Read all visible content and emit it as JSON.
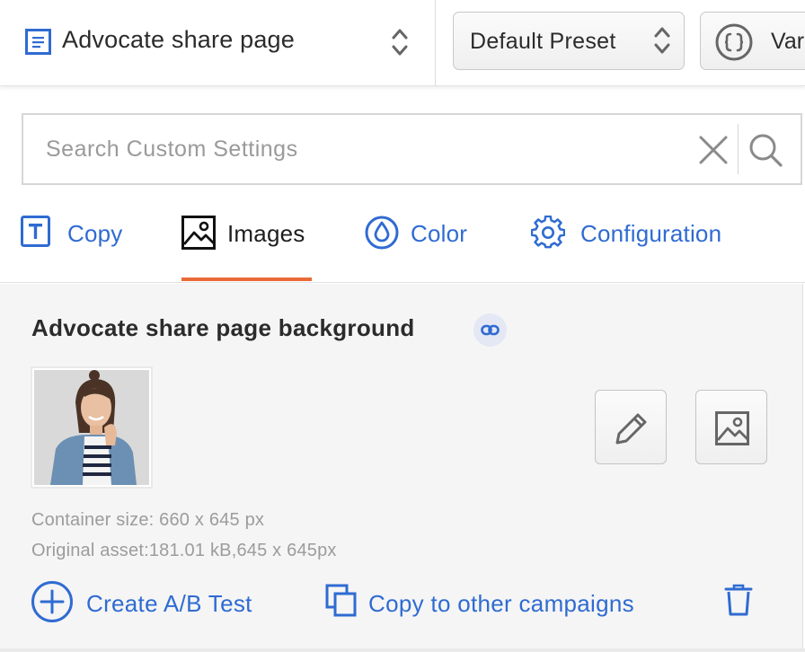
{
  "header": {
    "page_name": "Advocate share page",
    "preset_label": "Default Preset",
    "variables_label": "Variables"
  },
  "search": {
    "placeholder": "Search Custom Settings",
    "value": ""
  },
  "tabs": [
    {
      "label": "Copy",
      "icon": "text-icon",
      "active": false
    },
    {
      "label": "Images",
      "icon": "image-icon",
      "active": true
    },
    {
      "label": "Color",
      "icon": "droplet-icon",
      "active": false
    },
    {
      "label": "Configuration",
      "icon": "gear-icon",
      "active": false
    }
  ],
  "section": {
    "title": "Advocate share page background",
    "container_size": "Container size: 660 x 645 px",
    "original_asset": "Original asset:181.01 kB,645 x 645px",
    "thumbnail": "photo of smiling woman in denim shirt"
  },
  "actions": {
    "create_ab": "Create A/B Test",
    "copy_campaigns": "Copy to other campaigns"
  },
  "colors": {
    "accent_blue": "#2f6bd2",
    "active_tab_underline": "#ea6a37",
    "panel_bg": "#f5f5f5"
  }
}
